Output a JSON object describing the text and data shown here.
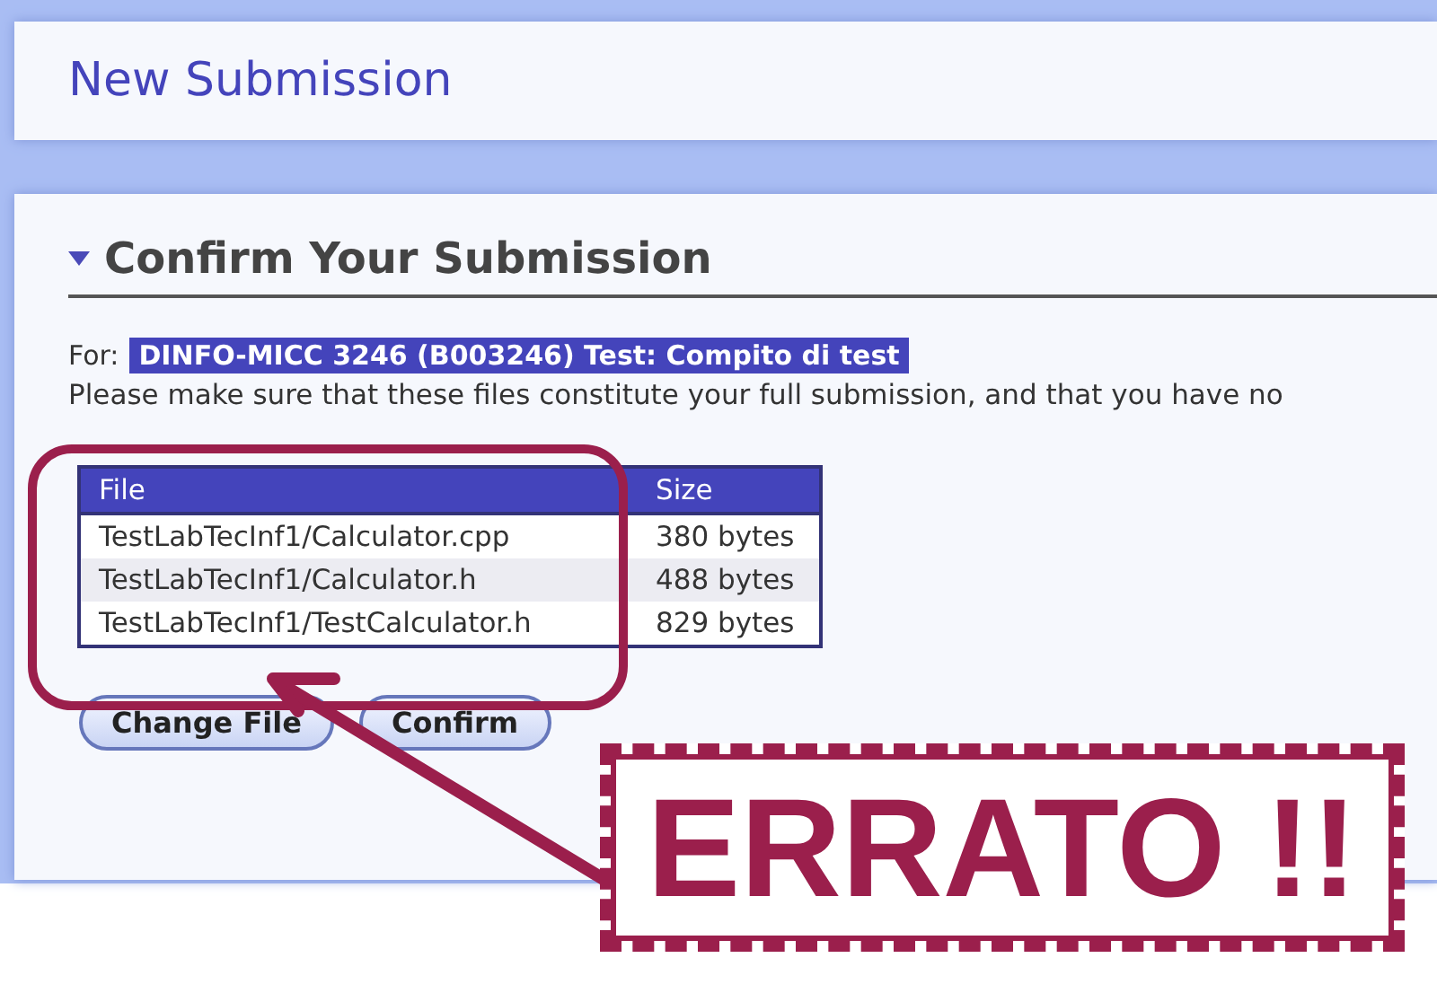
{
  "page_title": "New Submission",
  "section": {
    "title": "Confirm Your Submission",
    "expanded": true,
    "for_label": "For:",
    "for_value": "DINFO-MICC 3246 (B003246) Test: Compito di test",
    "instruction": "Please make sure that these files constitute your full submission, and that you have no",
    "table": {
      "columns": [
        "File",
        "Size"
      ],
      "rows": [
        {
          "cells": [
            "TestLabTecInf1/Calculator.cpp",
            "380 bytes"
          ]
        },
        {
          "cells": [
            "TestLabTecInf1/Calculator.h",
            "488 bytes"
          ]
        },
        {
          "cells": [
            "TestLabTecInf1/TestCalculator.h",
            "829 bytes"
          ]
        }
      ]
    },
    "buttons": [
      "Change File",
      "Confirm"
    ]
  },
  "annotation": {
    "text": "ERRATO !!"
  }
}
